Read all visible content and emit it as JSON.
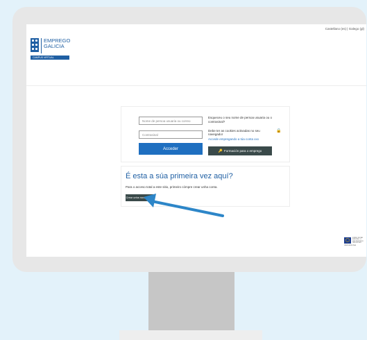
{
  "header": {
    "language_selector": "Castellano (es) | Galego (gl)",
    "logo": {
      "text_line1": "EMPREGO",
      "text_line2": "GALICIA",
      "bar_label": "CAMPUS VIRTUAL"
    }
  },
  "login": {
    "username_placeholder": "Nome de persoa usuaria ou correo",
    "password_placeholder": "Contrasinal",
    "submit_label": "Acceder",
    "forgot_text": "Esqueceu o seu nome de persoa usuaria ou o contrasinal?",
    "cookies_text": "Debe ter as cookies activadas no seu navegador",
    "access_link": "Accede empregando a túa conta xxx",
    "training_button": "Formación para o emprego"
  },
  "first_time": {
    "title": "É esta a súa primeira vez aquí?",
    "text": "Para o acceso total a este sitio, primeiro cómpre crear unha conta.",
    "create_button": "Crear unha nova conta"
  },
  "footer": {
    "eu_text": "FONDO SOCIAL EUROPEO. O FSE INVISTE NO TEU FUTURO",
    "eu_subtext": "UNIÓN EUROPEA"
  },
  "icons": [
    "lock-icon",
    "key-icon",
    "emprego-galicia-emblem",
    "arrow-pointer"
  ],
  "colors": {
    "brand_blue": "#1f5fa3",
    "button_blue": "#1f6fc0",
    "dark_button": "#3a4a4a",
    "arrow": "#2d86c8",
    "background": "#e3f2fa"
  }
}
